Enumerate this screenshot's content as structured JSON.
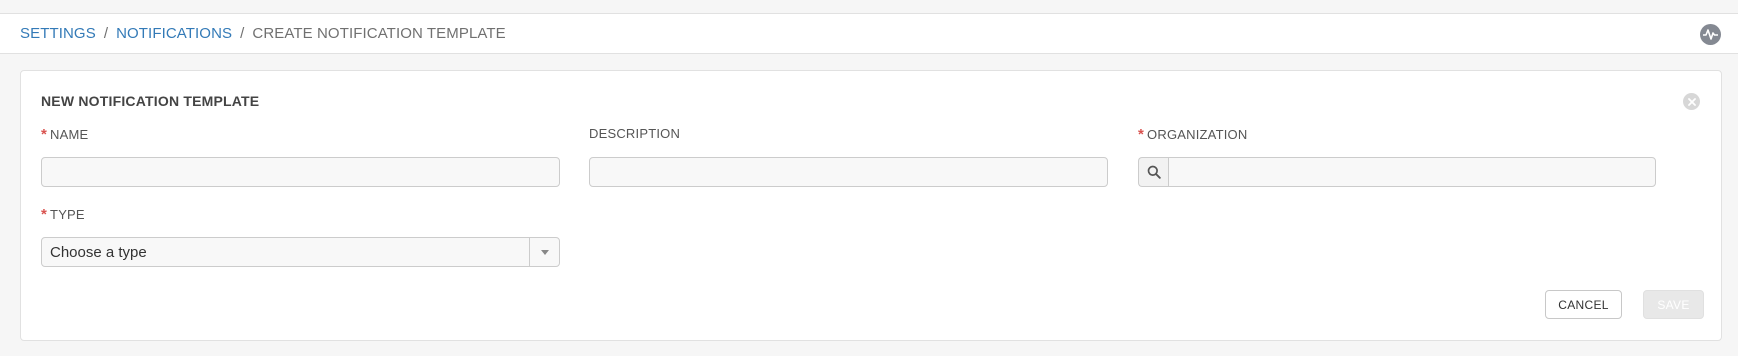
{
  "breadcrumb": {
    "items": [
      {
        "label": "SETTINGS"
      },
      {
        "label": "NOTIFICATIONS"
      },
      {
        "label": "CREATE NOTIFICATION TEMPLATE"
      }
    ],
    "separator": "/"
  },
  "header": {
    "activity_icon": "activity-stream-icon"
  },
  "form": {
    "title": "NEW NOTIFICATION TEMPLATE",
    "close_icon": "close-icon",
    "required_marker": "*",
    "fields": {
      "name": {
        "label": "NAME",
        "value": "",
        "placeholder": ""
      },
      "description": {
        "label": "DESCRIPTION",
        "value": "",
        "placeholder": ""
      },
      "organization": {
        "label": "ORGANIZATION",
        "value": "",
        "placeholder": "",
        "lookup_icon": "search-icon"
      },
      "type": {
        "label": "TYPE",
        "selected": "Choose a type"
      }
    },
    "buttons": {
      "cancel": "CANCEL",
      "save": "SAVE"
    }
  },
  "colors": {
    "link": "#337ab7",
    "required": "#d9534f",
    "disabled_button": "#e8e8e8"
  }
}
